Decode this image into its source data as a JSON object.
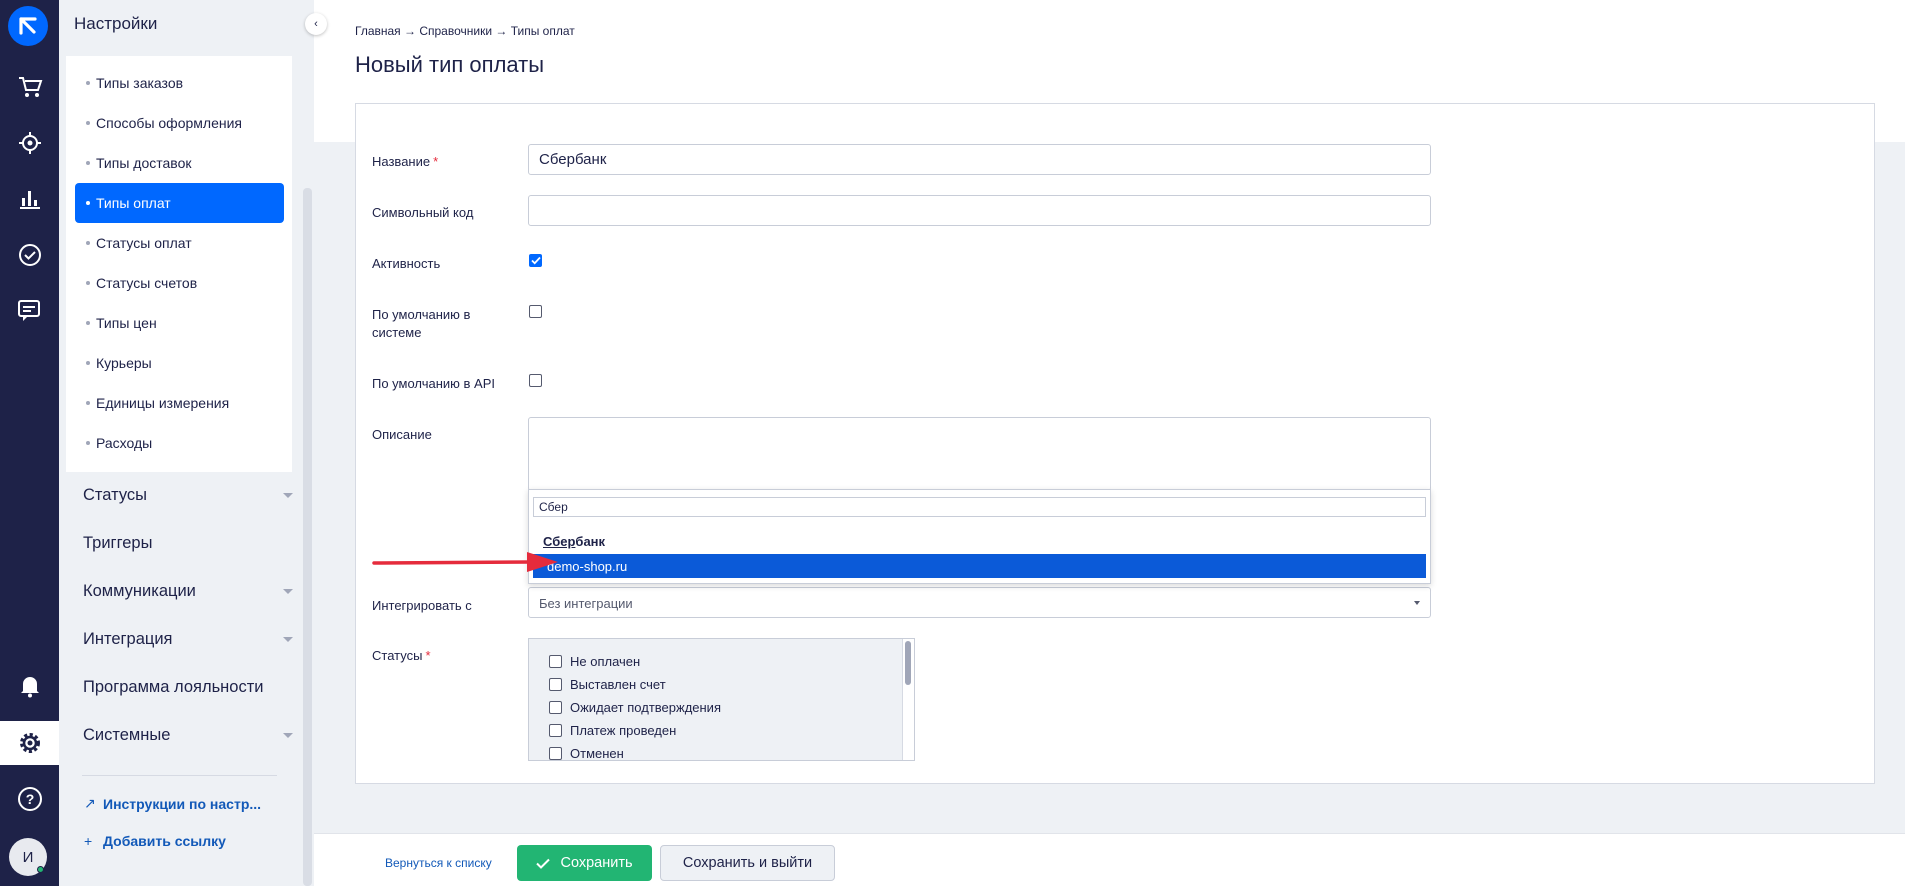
{
  "colors": {
    "rail_bg": "#1e2248",
    "accent_blue": "#0068ff",
    "save_green": "#22b573",
    "required_red": "#e52b3c",
    "arrow_red": "#e52b3c"
  },
  "rail": {
    "logo": "retailcrm-logo",
    "icons": [
      "cart-icon",
      "crosshair-icon",
      "analytics-icon",
      "tasks-check-icon",
      "chat-icon",
      "bell-icon",
      "gear-icon",
      "help-icon"
    ],
    "avatar_letter": "И"
  },
  "sidebar": {
    "title": "Настройки",
    "sub_items": [
      {
        "label": "Типы заказов"
      },
      {
        "label": "Способы оформления"
      },
      {
        "label": "Типы доставок"
      },
      {
        "label": "Типы оплат"
      },
      {
        "label": "Статусы оплат"
      },
      {
        "label": "Статусы счетов"
      },
      {
        "label": "Типы цен"
      },
      {
        "label": "Курьеры"
      },
      {
        "label": "Единицы измерения"
      },
      {
        "label": "Расходы"
      }
    ],
    "active_item": "Типы оплат",
    "sections": [
      {
        "label": "Статусы",
        "expandable": true
      },
      {
        "label": "Триггеры",
        "expandable": false
      },
      {
        "label": "Коммуникации",
        "expandable": true
      },
      {
        "label": "Интеграция",
        "expandable": true
      },
      {
        "label": "Программа лояльности",
        "expandable": false
      },
      {
        "label": "Системные",
        "expandable": true
      }
    ],
    "links": [
      {
        "label": "Инструкции по настр...",
        "icon": "arrow-up-right-icon"
      },
      {
        "label": "Добавить ссылку",
        "icon": "plus-icon"
      }
    ]
  },
  "page": {
    "breadcrumb": "Главная → Справочники → Типы оплат",
    "title": "Новый тип оплаты"
  },
  "form": {
    "name_label": "Название",
    "name_value": "Сбербанк",
    "code_label": "Символьный код",
    "code_value": "",
    "active_label": "Активность",
    "active_checked": true,
    "default_system_label": "По умолчанию в системе",
    "default_system_checked": false,
    "default_api_label": "По умолчанию в API",
    "default_api_checked": false,
    "description_label": "Описание",
    "integrate_label": "Интегрировать с",
    "integrate_value": "Без интеграции",
    "statuses_label": "Статусы"
  },
  "dropdown": {
    "search_value": "Сбер",
    "option_match": "Сбер",
    "option_rest": "банк",
    "option_highlighted": "demo-shop.ru"
  },
  "statuses": [
    {
      "label": "Не оплачен",
      "checked": false
    },
    {
      "label": "Выставлен счет",
      "checked": false
    },
    {
      "label": "Ожидает подтверждения",
      "checked": false
    },
    {
      "label": "Платеж проведен",
      "checked": false
    },
    {
      "label": "Отменен",
      "checked": false
    }
  ],
  "footer": {
    "back_label": "Вернуться к списку",
    "save_label": "Сохранить",
    "save_exit_label": "Сохранить и выйти"
  }
}
